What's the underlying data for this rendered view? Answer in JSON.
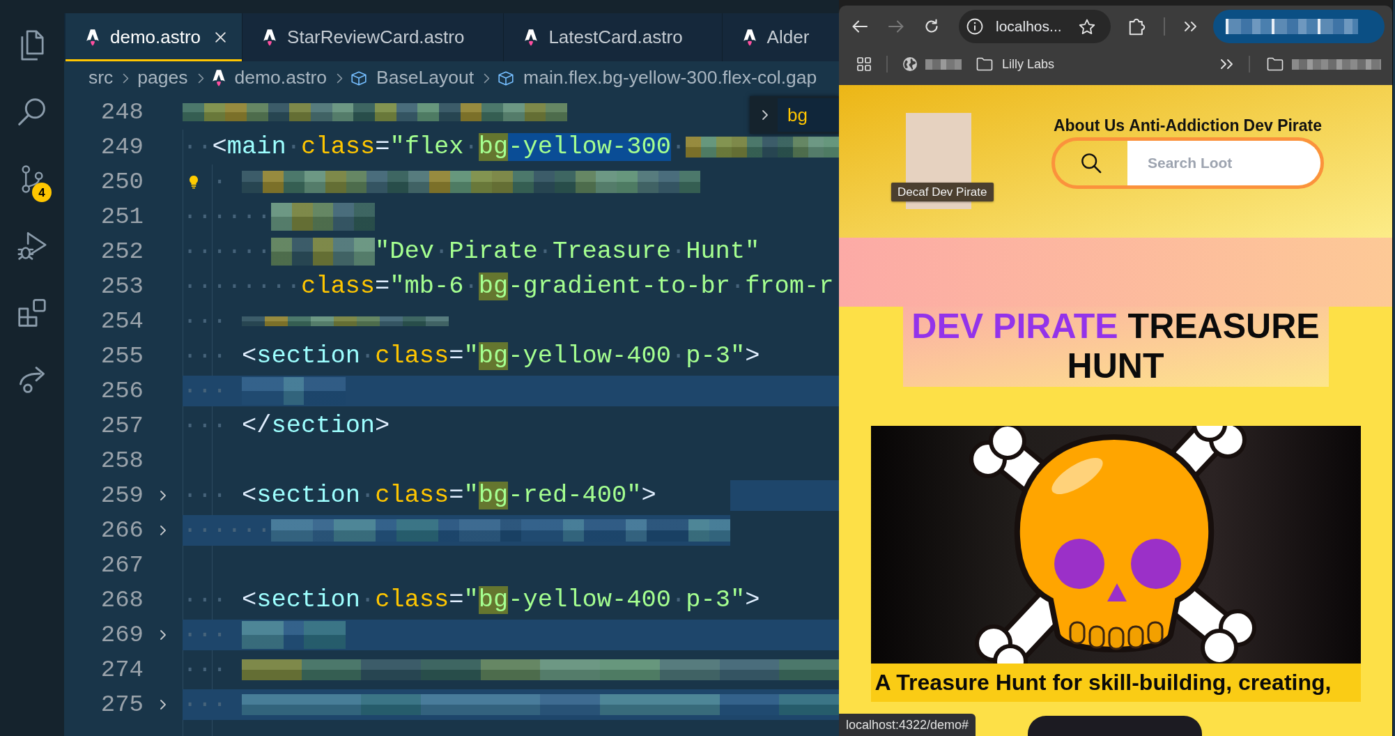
{
  "activity_bar": [
    {
      "kind": "explorer"
    },
    {
      "kind": "search"
    },
    {
      "kind": "source-control",
      "badge": "4"
    },
    {
      "kind": "run-debug"
    },
    {
      "kind": "extensions"
    },
    {
      "kind": "share"
    }
  ],
  "tabs": [
    {
      "label": "demo.astro",
      "selected": true
    },
    {
      "label": "StarReviewCard.astro",
      "selected": false
    },
    {
      "label": "LatestCard.astro",
      "selected": false
    },
    {
      "label": "Alder",
      "selected": false
    }
  ],
  "breadcrumbs": [
    {
      "kind": "folder",
      "label": "src"
    },
    {
      "kind": "folder",
      "label": "pages"
    },
    {
      "kind": "file",
      "label": "demo.astro"
    },
    {
      "kind": "symbol",
      "label": "BaseLayout"
    },
    {
      "kind": "symbol",
      "label": "main.flex.bg-yellow-300.flex-col.gap"
    }
  ],
  "find_widget": {
    "value": "bg"
  },
  "editor": {
    "lines": [
      {
        "number": "248",
        "kind": "plain",
        "folded": false,
        "tokens": [
          {
            "kind": "pixelated-long"
          }
        ]
      },
      {
        "number": "249",
        "kind": "plain",
        "folded": false,
        "tokens": [
          {
            "kind": "ws",
            "text": "··"
          },
          {
            "kind": "punct",
            "text": "<"
          },
          {
            "kind": "tag",
            "text": "main"
          },
          {
            "kind": "ws",
            "text": "·"
          },
          {
            "kind": "attr",
            "text": "class"
          },
          {
            "kind": "punct",
            "text": "="
          },
          {
            "kind": "str",
            "text": "\"flex"
          },
          {
            "kind": "ws",
            "text": "·"
          },
          {
            "kind": "str-match",
            "text": "bg"
          },
          {
            "kind": "str-selected",
            "text": "-yellow-300"
          },
          {
            "kind": "ws",
            "text": "·"
          },
          {
            "kind": "pixelated-rest"
          }
        ]
      },
      {
        "number": "250",
        "kind": "plain",
        "folded": false,
        "tokens": [
          {
            "kind": "lightbulb"
          },
          {
            "kind": "ws",
            "text": "· "
          },
          {
            "kind": "pixelated-wide"
          }
        ]
      },
      {
        "number": "251",
        "kind": "plain",
        "folded": false,
        "tokens": [
          {
            "kind": "ws",
            "text": "······"
          },
          {
            "kind": "pixelated-short"
          }
        ]
      },
      {
        "number": "252",
        "kind": "plain",
        "folded": false,
        "tokens": [
          {
            "kind": "ws",
            "text": "······"
          },
          {
            "kind": "pixelated-short"
          },
          {
            "kind": "str",
            "text": "\"Dev"
          },
          {
            "kind": "ws",
            "text": "·"
          },
          {
            "kind": "str",
            "text": "Pirate"
          },
          {
            "kind": "ws",
            "text": "·"
          },
          {
            "kind": "str",
            "text": "Treasure"
          },
          {
            "kind": "ws",
            "text": "·"
          },
          {
            "kind": "str",
            "text": "Hunt\""
          }
        ]
      },
      {
        "number": "253",
        "kind": "plain",
        "folded": false,
        "tokens": [
          {
            "kind": "ws",
            "text": "········"
          },
          {
            "kind": "attr",
            "text": "class"
          },
          {
            "kind": "punct",
            "text": "="
          },
          {
            "kind": "str",
            "text": "\"mb-6"
          },
          {
            "kind": "ws",
            "text": "·"
          },
          {
            "kind": "str-match",
            "text": "bg"
          },
          {
            "kind": "str",
            "text": "-gradient-to-br"
          },
          {
            "kind": "ws",
            "text": "·"
          },
          {
            "kind": "str",
            "text": "from-r"
          }
        ]
      },
      {
        "number": "254",
        "kind": "plain",
        "folded": false,
        "tokens": [
          {
            "kind": "ws",
            "text": "··· "
          },
          {
            "kind": "pixelated-medium"
          }
        ]
      },
      {
        "number": "255",
        "kind": "plain",
        "folded": false,
        "tokens": [
          {
            "kind": "ws",
            "text": "··· "
          },
          {
            "kind": "punct",
            "text": "<"
          },
          {
            "kind": "tag",
            "text": "section"
          },
          {
            "kind": "ws",
            "text": "·"
          },
          {
            "kind": "attr",
            "text": "class"
          },
          {
            "kind": "punct",
            "text": "="
          },
          {
            "kind": "str",
            "text": "\""
          },
          {
            "kind": "str-match",
            "text": "bg"
          },
          {
            "kind": "str",
            "text": "-yellow-400"
          },
          {
            "kind": "ws",
            "text": "·"
          },
          {
            "kind": "str",
            "text": "p-3\""
          },
          {
            "kind": "punct",
            "text": ">"
          }
        ]
      },
      {
        "number": "256",
        "kind": "band",
        "folded": false,
        "tokens": [
          {
            "kind": "ws",
            "text": "··· "
          },
          {
            "kind": "pixelated-short"
          }
        ]
      },
      {
        "number": "257",
        "kind": "plain",
        "folded": false,
        "tokens": [
          {
            "kind": "ws",
            "text": "··· "
          },
          {
            "kind": "punct",
            "text": "</"
          },
          {
            "kind": "tag",
            "text": "section"
          },
          {
            "kind": "punct",
            "text": ">"
          }
        ]
      },
      {
        "number": "258",
        "kind": "plain",
        "folded": false
      },
      {
        "number": "259",
        "kind": "band-tail",
        "folded": true,
        "tokens": [
          {
            "kind": "ws",
            "text": "··· "
          },
          {
            "kind": "punct",
            "text": "<"
          },
          {
            "kind": "tag",
            "text": "section"
          },
          {
            "kind": "ws",
            "text": "·"
          },
          {
            "kind": "attr",
            "text": "class"
          },
          {
            "kind": "punct",
            "text": "="
          },
          {
            "kind": "str",
            "text": "\""
          },
          {
            "kind": "str-match",
            "text": "bg"
          },
          {
            "kind": "str",
            "text": "-red-400\""
          },
          {
            "kind": "punct",
            "text": ">"
          }
        ]
      },
      {
        "number": "266",
        "kind": "band-head",
        "folded": true,
        "tokens": [
          {
            "kind": "ws",
            "text": "······"
          },
          {
            "kind": "pixelated-wide"
          }
        ]
      },
      {
        "number": "267",
        "kind": "plain",
        "folded": false
      },
      {
        "number": "268",
        "kind": "plain",
        "folded": false,
        "tokens": [
          {
            "kind": "ws",
            "text": "··· "
          },
          {
            "kind": "punct",
            "text": "<"
          },
          {
            "kind": "tag",
            "text": "section"
          },
          {
            "kind": "ws",
            "text": "·"
          },
          {
            "kind": "attr",
            "text": "class"
          },
          {
            "kind": "punct",
            "text": "="
          },
          {
            "kind": "str",
            "text": "\""
          },
          {
            "kind": "str-match",
            "text": "bg"
          },
          {
            "kind": "str",
            "text": "-yellow-400"
          },
          {
            "kind": "ws",
            "text": "·"
          },
          {
            "kind": "str",
            "text": "p-3\""
          },
          {
            "kind": "punct",
            "text": ">"
          }
        ]
      },
      {
        "number": "269",
        "kind": "band",
        "folded": true,
        "tokens": [
          {
            "kind": "ws",
            "text": "··· "
          },
          {
            "kind": "pixelated-short"
          }
        ]
      },
      {
        "number": "274",
        "kind": "plain",
        "folded": false,
        "tokens": [
          {
            "kind": "ws",
            "text": "··· "
          },
          {
            "kind": "pixelated-rest"
          }
        ]
      },
      {
        "number": "275",
        "kind": "band",
        "folded": true,
        "tokens": [
          {
            "kind": "ws",
            "text": "··· "
          },
          {
            "kind": "pixelated-rest"
          }
        ]
      }
    ]
  },
  "browser": {
    "nav_buttons": [
      {
        "kind": "back",
        "disabled": false
      },
      {
        "kind": "forward",
        "disabled": true
      },
      {
        "kind": "reload",
        "disabled": false
      }
    ],
    "address": "localhos...",
    "bookmarks": [
      {
        "kind": "apps"
      },
      {
        "kind": "site",
        "redacted": true
      },
      {
        "kind": "folder",
        "redacted": false,
        "label": "Lilly Labs"
      },
      {
        "kind": "more"
      },
      {
        "kind": "folder",
        "redacted": true
      }
    ],
    "status_url": "localhost:4322/demo#"
  },
  "page": {
    "avatar_tooltip": "Decaf Dev Pirate",
    "nav_links": [
      "About Us",
      "Anti-Addiction",
      "Dev Pirate"
    ],
    "search": {
      "placeholder": "Search Loot"
    },
    "heading": {
      "accent": "DEV PIRATE",
      "rest": "TREASURE HUNT"
    },
    "caption": "A Treasure Hunt for skill-building, creating,"
  }
}
